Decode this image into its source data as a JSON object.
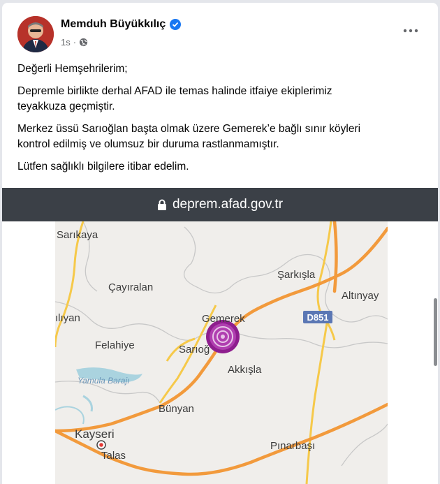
{
  "post": {
    "author": "Memduh Büyükkılıç",
    "time": "1s",
    "paragraphs": [
      "Değerli Hemşehrilerim;",
      "Depremle birlikte derhal AFAD ile temas halinde itfaiye ekiplerimiz\nteyakkuza geçmiştir.",
      "Merkez üssü Sarıoğlan başta olmak üzere Gemerek’e bağlı sınır köyleri\nkontrol edilmiş ve olumsuz bir duruma rastlanmamıştır.",
      "Lütfen sağlıklı bilgilere itibar edelim."
    ]
  },
  "screenshot": {
    "url": "deprem.afad.gov.tr",
    "map_labels": {
      "sarikaya": "Sarıkaya",
      "cayiralan": "Çayıralan",
      "sarkisla": "Şarkışla",
      "altinyayla": "Altınyay",
      "yildizeli_partial": "ılıyan",
      "gemerek": "Gemerek",
      "road_d851": "D851",
      "felahiye": "Felahiye",
      "sarioglan": "Sarıoğ",
      "akkisla": "Akkışla",
      "yamula": "Yamula Barajı",
      "bunyan": "Bünyan",
      "kayseri": "Kayseri",
      "talas": "Talas",
      "pinarbasi": "Pınarbaşı"
    }
  },
  "icons": {
    "verified": "verified-badge-icon",
    "audience": "globe-icon",
    "more": "more-options-icon",
    "lock": "lock-icon"
  },
  "colors": {
    "verified": "#1877f2",
    "url_bar": "#3b4047",
    "epicenter": "#8e1e8e",
    "road_major": "#f29a3c",
    "road_minor": "#f6c94a",
    "water": "#aad3df"
  }
}
